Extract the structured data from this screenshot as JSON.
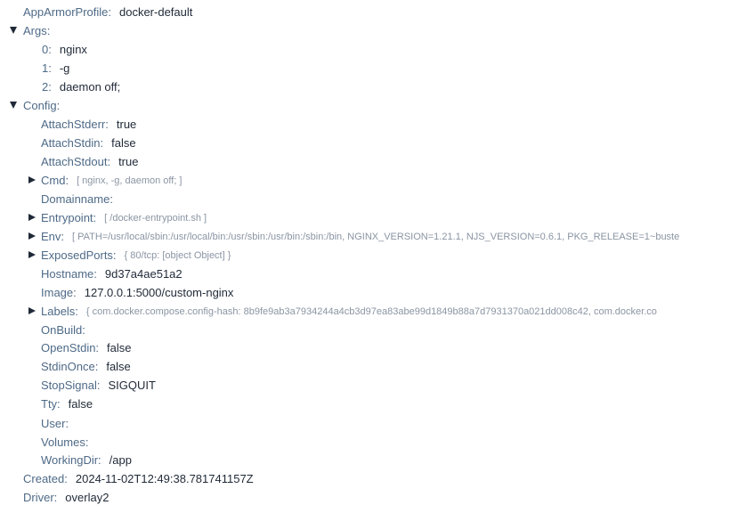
{
  "tree": {
    "apparmor": {
      "key": "AppArmorProfile:",
      "value": "docker-default"
    },
    "args": {
      "key": "Args:",
      "items": [
        {
          "index": "0:",
          "value": "nginx"
        },
        {
          "index": "1:",
          "value": "-g"
        },
        {
          "index": "2:",
          "value": "daemon off;"
        }
      ]
    },
    "config": {
      "key": "Config:",
      "attach_stderr": {
        "key": "AttachStderr:",
        "value": "true"
      },
      "attach_stdin": {
        "key": "AttachStdin:",
        "value": "false"
      },
      "attach_stdout": {
        "key": "AttachStdout:",
        "value": "true"
      },
      "cmd": {
        "key": "Cmd:",
        "summary": "[ nginx, -g, daemon off; ]"
      },
      "domainname": {
        "key": "Domainname:",
        "value": ""
      },
      "entrypoint": {
        "key": "Entrypoint:",
        "summary": "[ /docker-entrypoint.sh ]"
      },
      "env": {
        "key": "Env:",
        "summary": "[ PATH=/usr/local/sbin:/usr/local/bin:/usr/sbin:/usr/bin:/sbin:/bin, NGINX_VERSION=1.21.1, NJS_VERSION=0.6.1, PKG_RELEASE=1~buste"
      },
      "exposed_ports": {
        "key": "ExposedPorts:",
        "summary": "{ 80/tcp: [object Object] }"
      },
      "hostname": {
        "key": "Hostname:",
        "value": "9d37a4ae51a2"
      },
      "image": {
        "key": "Image:",
        "value": "127.0.0.1:5000/custom-nginx"
      },
      "labels": {
        "key": "Labels:",
        "summary": "{ com.docker.compose.config-hash: 8b9fe9ab3a7934244a4cb3d97ea83abe99d1849b88a7d7931370a021dd008c42, com.docker.co"
      },
      "onbuild": {
        "key": "OnBuild:",
        "value": ""
      },
      "open_stdin": {
        "key": "OpenStdin:",
        "value": "false"
      },
      "stdin_once": {
        "key": "StdinOnce:",
        "value": "false"
      },
      "stop_signal": {
        "key": "StopSignal:",
        "value": "SIGQUIT"
      },
      "tty": {
        "key": "Tty:",
        "value": "false"
      },
      "user": {
        "key": "User:",
        "value": ""
      },
      "volumes": {
        "key": "Volumes:",
        "value": ""
      },
      "working_dir": {
        "key": "WorkingDir:",
        "value": "/app"
      }
    },
    "created": {
      "key": "Created:",
      "value": "2024-11-02T12:49:38.781741157Z"
    },
    "driver": {
      "key": "Driver:",
      "value": "overlay2"
    }
  },
  "colors": {
    "key": "#4e6a87",
    "value": "#1f2937",
    "summary": "#8a95a3"
  },
  "icons": {
    "expanded": "caret-down-icon",
    "collapsed": "caret-right-icon"
  }
}
